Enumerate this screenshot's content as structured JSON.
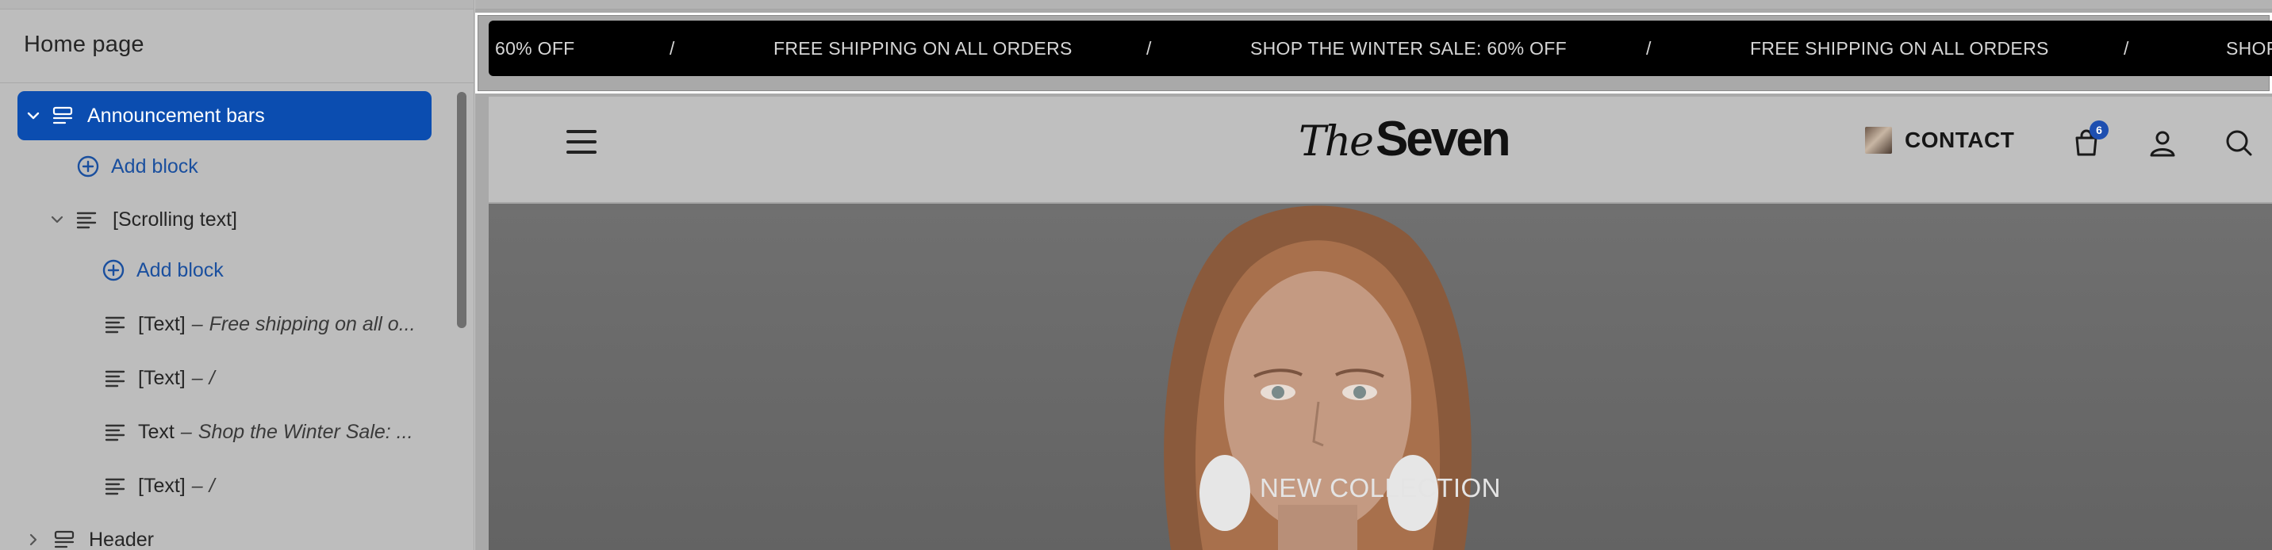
{
  "left_panel": {
    "title": "Home page",
    "tree": [
      {
        "label": "Announcement bars",
        "icon": "section-icon",
        "expanded": true,
        "selected": true
      },
      {
        "label": "Add block",
        "icon": "plus-circle-icon",
        "kind": "action"
      },
      {
        "label": "[Scrolling text]",
        "icon": "text-lines-icon",
        "expanded": true
      },
      {
        "label": "Add block",
        "icon": "plus-circle-icon",
        "kind": "action"
      },
      {
        "label": "[Text]",
        "suffix": "Free shipping on all o...",
        "icon": "text-lines-icon"
      },
      {
        "label": "[Text]",
        "suffix": "/",
        "icon": "text-lines-icon"
      },
      {
        "label": "Text",
        "suffix": "Shop the Winter Sale: ...",
        "icon": "text-lines-icon"
      },
      {
        "label": "[Text]",
        "suffix": "/",
        "icon": "text-lines-icon"
      },
      {
        "label": "Header",
        "icon": "section-icon",
        "expanded": false
      }
    ],
    "dash": "–"
  },
  "preview": {
    "announcement_items": [
      "60% OFF",
      "/",
      "FREE SHIPPING ON ALL ORDERS",
      "/",
      "SHOP THE WINTER SALE: 60% OFF",
      "/",
      "FREE SHIPPING ON ALL ORDERS",
      "/",
      "SHOP"
    ],
    "header": {
      "logo_the": "The",
      "logo_seven": "Seven",
      "contact_label": "CONTACT",
      "cart_count": "6"
    },
    "hero": {
      "caption": "NEW COLLECTION"
    }
  },
  "colors": {
    "accent": "#0b4db0",
    "link": "#1a4f9e",
    "announcement_bg": "#000000",
    "badge": "#1e4fb0"
  }
}
